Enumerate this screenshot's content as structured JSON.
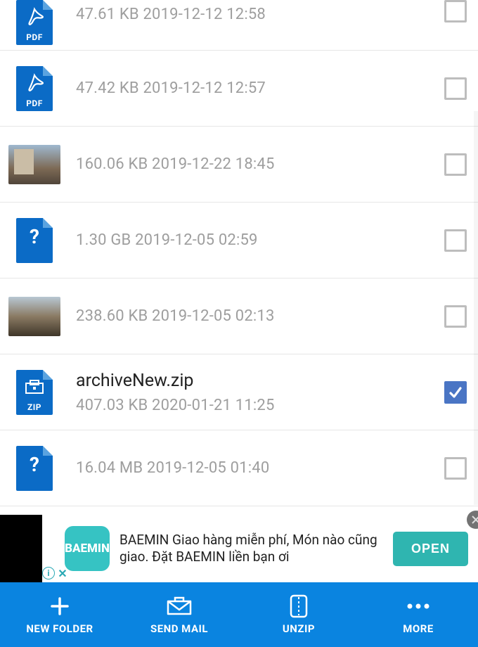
{
  "files": [
    {
      "icon": "pdf",
      "name": "",
      "size": "47.61 KB",
      "date": "2019-12-12 12:58",
      "checked": false
    },
    {
      "icon": "pdf",
      "name": "",
      "size": "47.42 KB",
      "date": "2019-12-12 12:57",
      "checked": false
    },
    {
      "icon": "image1",
      "name": "",
      "size": "160.06 KB",
      "date": "2019-12-22 18:45",
      "checked": false
    },
    {
      "icon": "unknown",
      "name": "",
      "size": "1.30 GB",
      "date": "2019-12-05 02:59",
      "checked": false
    },
    {
      "icon": "image2",
      "name": "",
      "size": "238.60 KB",
      "date": "2019-12-05 02:13",
      "checked": false
    },
    {
      "icon": "zip",
      "name": "archiveNew.zip",
      "size": "407.03 KB",
      "date": "2020-01-21 11:25",
      "checked": true
    },
    {
      "icon": "unknown",
      "name": "",
      "size": "16.04 MB",
      "date": "2019-12-05 01:40",
      "checked": false
    }
  ],
  "icon_labels": {
    "pdf": "PDF",
    "zip": "ZIP",
    "unknown": "?"
  },
  "ad": {
    "logo_text": "BAE\nMIN",
    "text": "BAEMIN Giao hàng miễn phí, Món nào cũng giao. Đặt BAEMIN liền bạn ơi",
    "button": "OPEN"
  },
  "actions": {
    "new_folder": "NEW FOLDER",
    "send_mail": "SEND MAIL",
    "unzip": "UNZIP",
    "more": "MORE"
  }
}
